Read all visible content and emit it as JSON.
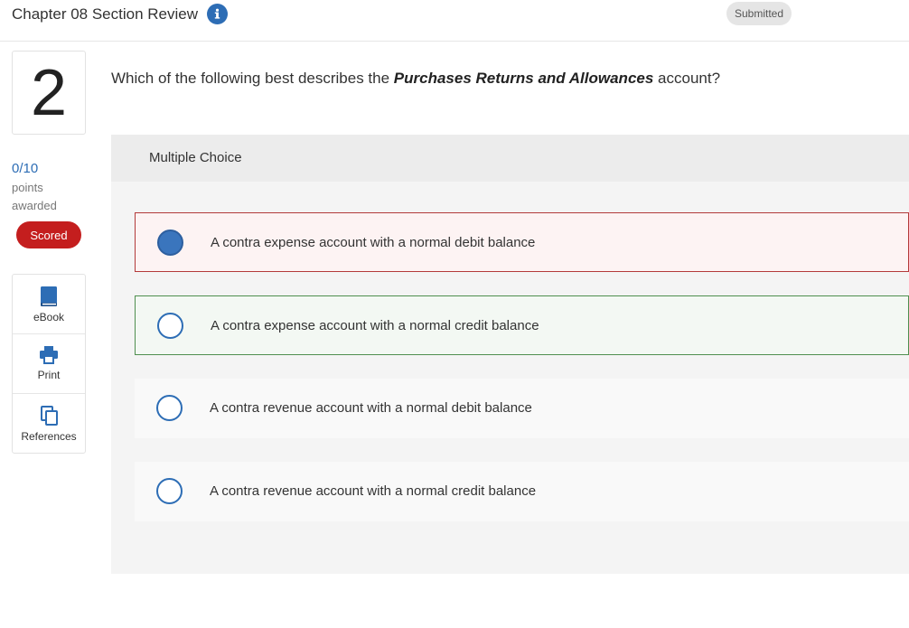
{
  "header": {
    "title": "Chapter 08 Section Review",
    "status_badge": "Submitted"
  },
  "question": {
    "number": "2",
    "text_before": "Which of the following best describes the ",
    "text_emphasis": "Purchases Returns and Allowances",
    "text_after": " account?"
  },
  "score": {
    "value": "0/10",
    "label": "points awarded",
    "badge": "Scored"
  },
  "tools": [
    {
      "label": "eBook",
      "icon": "book-icon"
    },
    {
      "label": "Print",
      "icon": "printer-icon"
    },
    {
      "label": "References",
      "icon": "copy-icon"
    }
  ],
  "answer_panel": {
    "title": "Multiple Choice",
    "choices": [
      {
        "text": "A contra expense account with a normal debit balance",
        "selected": true,
        "state": "incorrect"
      },
      {
        "text": "A contra expense account with a normal credit balance",
        "selected": false,
        "state": "correct"
      },
      {
        "text": "A contra revenue account with a normal debit balance",
        "selected": false,
        "state": "neutral"
      },
      {
        "text": "A contra revenue account with a normal credit balance",
        "selected": false,
        "state": "neutral"
      }
    ]
  },
  "colors": {
    "accent": "#2d6db5",
    "scored_badge": "#c41e1e",
    "incorrect_border": "#b33a3a",
    "correct_border": "#4f8f4f"
  }
}
